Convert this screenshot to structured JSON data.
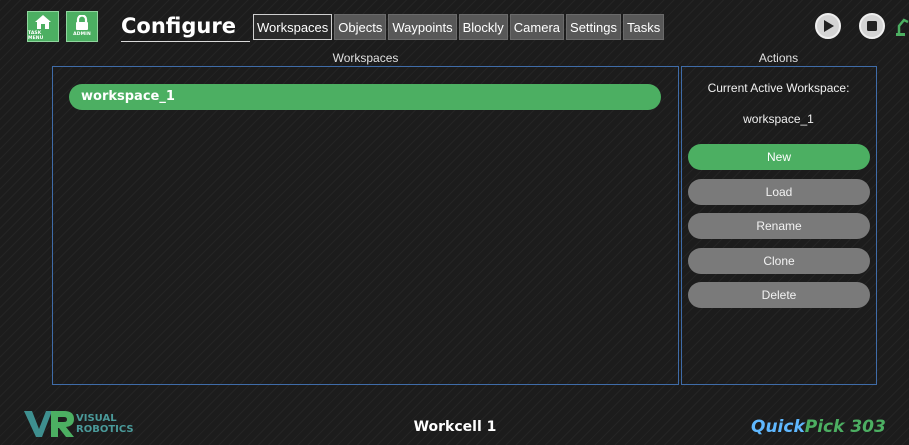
{
  "header": {
    "task_menu_label": "TASK MENU",
    "admin_label": "ADMIN",
    "title": "Configure",
    "tabs": [
      "Workspaces",
      "Objects",
      "Waypoints",
      "Blockly",
      "Camera",
      "Settings",
      "Tasks"
    ],
    "active_tab": "Workspaces"
  },
  "workspaces_panel": {
    "header": "Workspaces",
    "items": [
      "workspace_1"
    ]
  },
  "actions_panel": {
    "header": "Actions",
    "current_label": "Current Active Workspace:",
    "current_value": "workspace_1",
    "buttons": [
      "New",
      "Load",
      "Rename",
      "Clone",
      "Delete"
    ]
  },
  "footer": {
    "logo_line1": "VISUAL",
    "logo_line2": "ROBOTICS",
    "workcell": "Workcell 1",
    "product_part1": "Quick",
    "product_part2": "Pick 303"
  },
  "colors": {
    "accent_green": "#4caf62",
    "panel_border": "#3f6ca8",
    "button_gray": "#7a7a7a"
  }
}
